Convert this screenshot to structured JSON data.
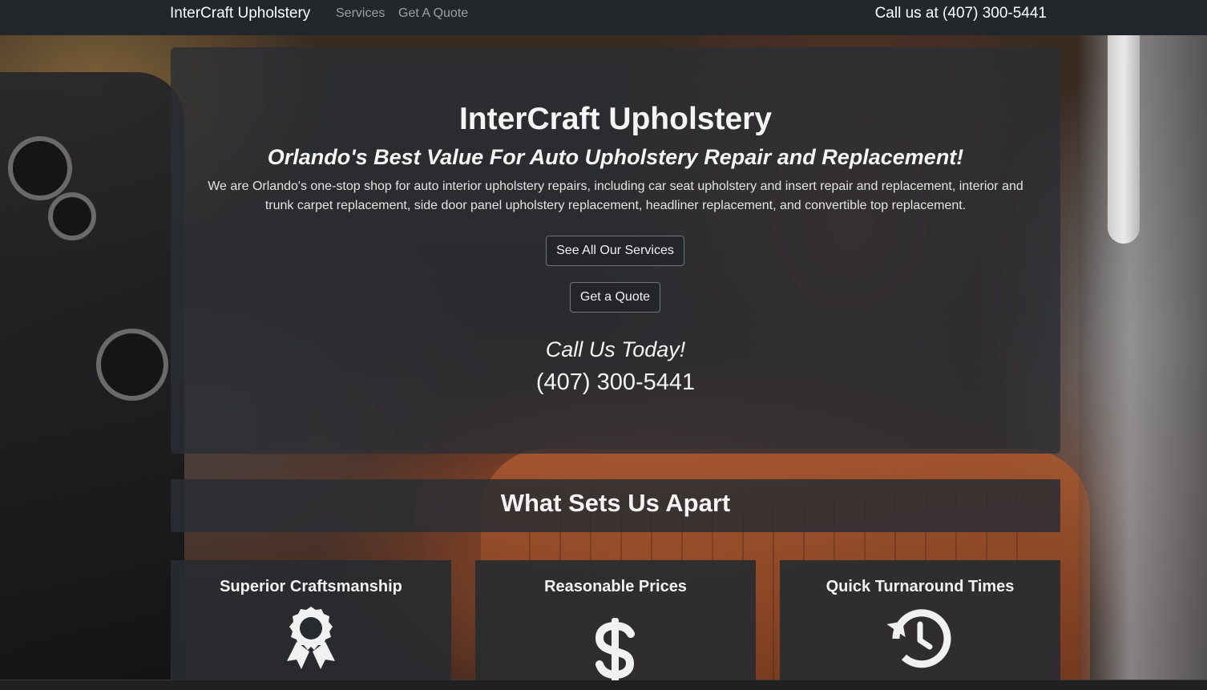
{
  "navbar": {
    "brand": "InterCraft Upholstery",
    "links": [
      {
        "label": "Services"
      },
      {
        "label": "Get A Quote"
      }
    ],
    "phone": "Call us at (407) 300-5441"
  },
  "hero": {
    "title": "InterCraft Upholstery",
    "subtitle": "Orlando's Best Value For Auto Upholstery Repair and Replacement!",
    "description": "We are Orlando's one-stop shop for auto interior upholstery repairs, including car seat upholstery and insert repair and replacement, interior and trunk carpet replacement, side door panel upholstery replacement, headliner replacement, and convertible top replacement.",
    "buttons": {
      "services": "See All Our Services",
      "quote": "Get a Quote"
    },
    "call_today": "Call Us Today!",
    "phone": "(407) 300-5441"
  },
  "section": {
    "title": "What Sets Us Apart"
  },
  "features": [
    {
      "title": "Superior Craftsmanship",
      "icon": "award-icon"
    },
    {
      "title": "Reasonable Prices",
      "icon": "dollar-icon"
    },
    {
      "title": "Quick Turnaround Times",
      "icon": "history-icon"
    }
  ],
  "colors": {
    "navbar_bg": "#22272b",
    "card_bg": "rgba(42,46,52,0.80)",
    "text": "#f4f4f4",
    "nav_link": "#9aa0a6"
  }
}
